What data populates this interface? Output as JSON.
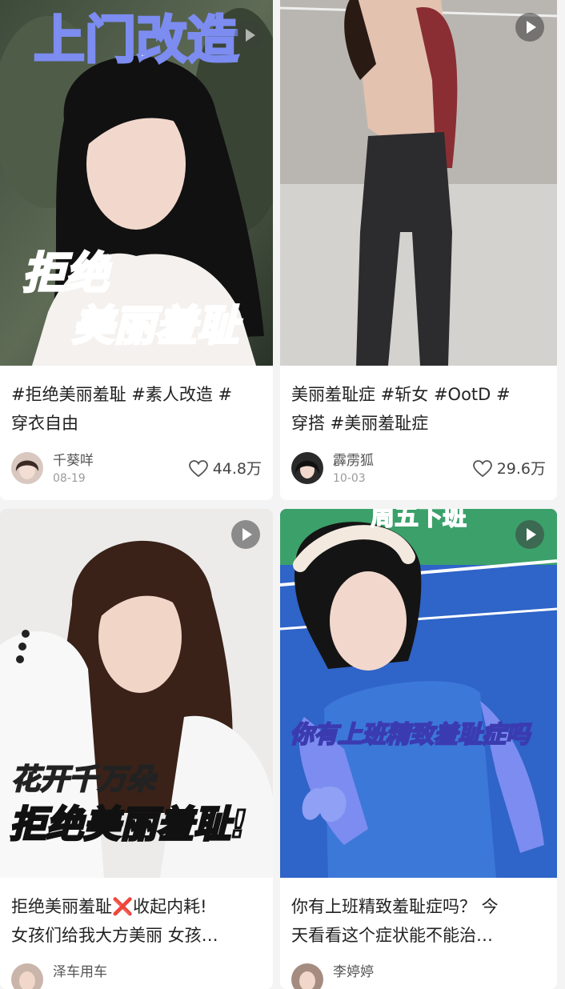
{
  "cards": [
    {
      "overlay_top": "上门改造",
      "overlay_line1": "拒绝",
      "overlay_line2": "美丽羞耻",
      "caption_line1": "#拒绝美丽羞耻 #素人改造 #",
      "caption_line2": "穿衣自由",
      "author": "千葵咩",
      "date": "08-19",
      "likes": "44.8万"
    },
    {
      "caption_line1": "美丽羞耻症 #斩女  #OotD  #",
      "caption_line2": "穿搭  #美丽羞耻症",
      "author": "霹雳狐",
      "date": "10-03",
      "likes": "29.6万"
    },
    {
      "overlay_line1": "花开千万朵",
      "overlay_line2": "拒绝美丽羞耻!",
      "caption_line1": "拒绝美丽羞耻❌收起内耗!",
      "caption_line2": "女孩们给我大方美丽 女孩…",
      "author": "泽车用车"
    },
    {
      "overlay_top": "周五下班",
      "overlay_line1": "你有上班精致羞耻症吗",
      "caption_line1": "你有上班精致羞耻症吗？ 今",
      "caption_line2": "天看看这个症状能不能治…",
      "author": "李婷婷"
    }
  ],
  "colors": {
    "overlay_blue": "#7c8cf0",
    "overlay_yellow": "#f7d84a",
    "court_blue": "#2f64c8",
    "dress_blue": "#3c78d8"
  }
}
